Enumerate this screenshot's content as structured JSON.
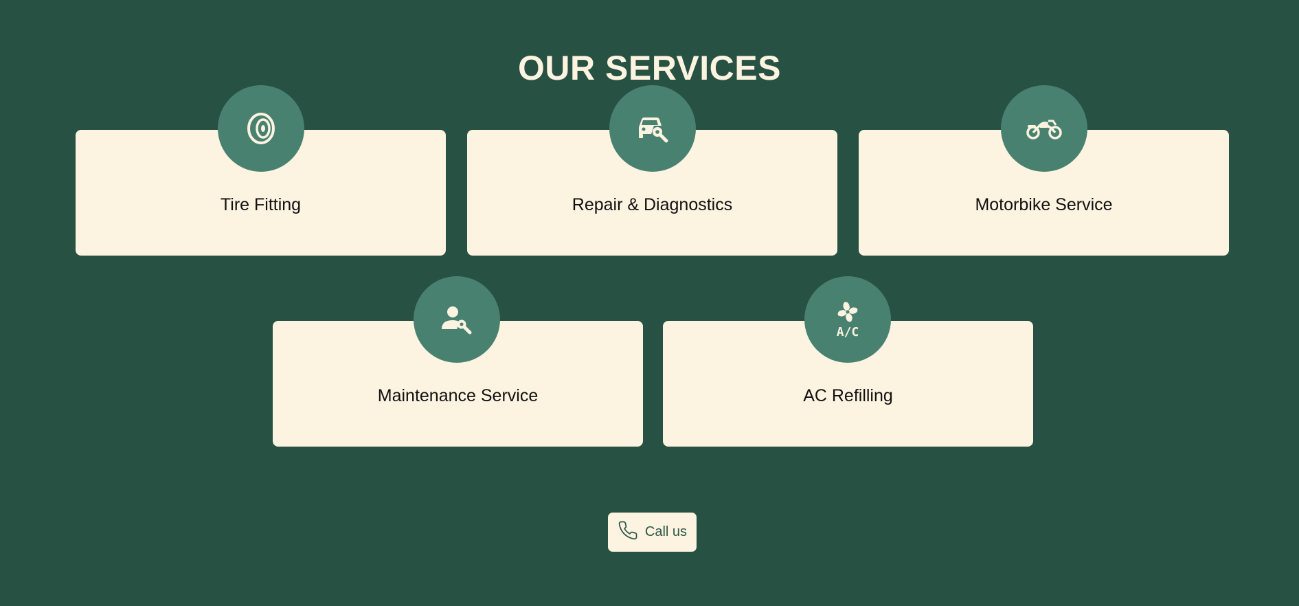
{
  "section": {
    "title": "OUR SERVICES"
  },
  "services": [
    {
      "label": "Tire Fitting",
      "icon": "tire-icon"
    },
    {
      "label": "Repair & Diagnostics",
      "icon": "car-wrench-icon"
    },
    {
      "label": "Motorbike Service",
      "icon": "motorbike-icon"
    },
    {
      "label": "Maintenance Service",
      "icon": "mechanic-icon"
    },
    {
      "label": "AC Refilling",
      "icon": "ac-fan-icon"
    }
  ],
  "cta": {
    "label": "Call us",
    "icon": "phone-icon"
  },
  "colors": {
    "background": "#275142",
    "card": "#fcf3e1",
    "icon_circle": "#498170",
    "title": "#fcf3e1",
    "cta_text": "#2d5747"
  }
}
